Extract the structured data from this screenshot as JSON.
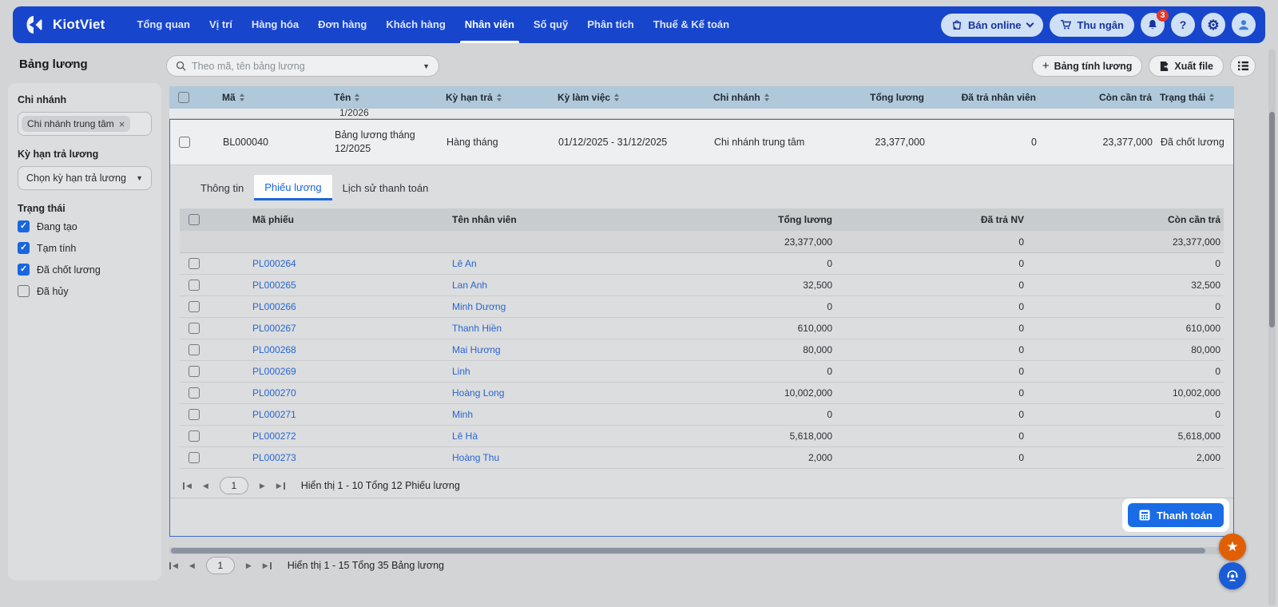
{
  "colors": {
    "navbar": "#1746cd",
    "accent": "#1a6ce6",
    "link": "#2766cf",
    "badge_red": "#e23a2e",
    "header_blue": "#afc9db",
    "star_orange": "#e05f04"
  },
  "nav": {
    "brand": "KiotViet",
    "items": [
      {
        "label": "Tổng quan",
        "active": false
      },
      {
        "label": "Vị trí",
        "active": false
      },
      {
        "label": "Hàng hóa",
        "active": false
      },
      {
        "label": "Đơn hàng",
        "active": false
      },
      {
        "label": "Khách hàng",
        "active": false
      },
      {
        "label": "Nhân viên",
        "active": true
      },
      {
        "label": "Số quỹ",
        "active": false
      },
      {
        "label": "Phân tích",
        "active": false
      },
      {
        "label": "Thuế & Kế toán",
        "active": false
      }
    ],
    "ban_online_label": "Bán online",
    "thu_ngan_label": "Thu ngân",
    "notification_badge": "3",
    "help_glyph": "?",
    "gear_glyph": "⚙"
  },
  "sidebar": {
    "title": "Bảng lương",
    "branch_label": "Chi nhánh",
    "branch_chip": "Chi nhánh trung tâm",
    "chip_close_glyph": "×",
    "term_label": "Kỳ hạn trả lương",
    "term_placeholder": "Chọn kỳ hạn trả lương",
    "status_label": "Trạng thái",
    "statuses": [
      {
        "label": "Đang tạo",
        "checked": true
      },
      {
        "label": "Tạm tính",
        "checked": true
      },
      {
        "label": "Đã chốt lương",
        "checked": true
      },
      {
        "label": "Đã hủy",
        "checked": false
      }
    ]
  },
  "toolbar": {
    "search_placeholder": "Theo mã, tên bảng lương",
    "create_plus_glyph": "+",
    "create_label": "Bảng tính lương",
    "export_label": "Xuất file"
  },
  "outer_table": {
    "headers": [
      {
        "label": "Mã",
        "sort": true,
        "cls": "first"
      },
      {
        "label": "Tên",
        "sort": true,
        "cls": "pad"
      },
      {
        "label": "Kỳ hạn trả",
        "sort": true,
        "cls": "pad"
      },
      {
        "label": "Kỳ làm việc",
        "sort": true,
        "cls": "pad"
      },
      {
        "label": "Chi nhánh",
        "sort": true,
        "cls": "pad"
      },
      {
        "label": "Tổng lương",
        "sort": false,
        "cls": "right"
      },
      {
        "label": "Đã trả nhân viên",
        "sort": false,
        "cls": "right"
      },
      {
        "label": "Còn cần trả",
        "sort": false,
        "cls": "right"
      },
      {
        "label": "Trạng thái",
        "sort": true,
        "cls": ""
      }
    ],
    "partial_row_text": "1/2026",
    "expanded_row": {
      "code": "BL000040",
      "name": "Bảng lương tháng 12/2025",
      "term": "Hàng tháng",
      "period": "01/12/2025 - 31/12/2025",
      "branch": "Chi nhánh trung tâm",
      "total": "23,377,000",
      "paid": "0",
      "remaining": "23,377,000",
      "status": "Đã chốt lương"
    }
  },
  "detail": {
    "tabs": [
      {
        "label": "Thông tin",
        "active": false
      },
      {
        "label": "Phiếu lương",
        "active": true
      },
      {
        "label": "Lịch sử thanh toán",
        "active": false
      }
    ],
    "inner_headers": [
      "Mã phiếu",
      "Tên nhân viên",
      "Tổng lương",
      "Đã trả NV",
      "Còn cần trả"
    ],
    "summary": {
      "total": "23,377,000",
      "paid": "0",
      "remaining": "23,377,000"
    },
    "rows": [
      {
        "code": "PL000264",
        "name": "Lê An",
        "total": "0",
        "paid": "0",
        "remaining": "0"
      },
      {
        "code": "PL000265",
        "name": "Lan Anh",
        "total": "32,500",
        "paid": "0",
        "remaining": "32,500"
      },
      {
        "code": "PL000266",
        "name": "Minh Dương",
        "total": "0",
        "paid": "0",
        "remaining": "0"
      },
      {
        "code": "PL000267",
        "name": "Thanh Hiền",
        "total": "610,000",
        "paid": "0",
        "remaining": "610,000"
      },
      {
        "code": "PL000268",
        "name": "Mai Hương",
        "total": "80,000",
        "paid": "0",
        "remaining": "80,000"
      },
      {
        "code": "PL000269",
        "name": "Linh",
        "total": "0",
        "paid": "0",
        "remaining": "0"
      },
      {
        "code": "PL000270",
        "name": "Hoàng Long",
        "total": "10,002,000",
        "paid": "0",
        "remaining": "10,002,000"
      },
      {
        "code": "PL000271",
        "name": "Minh",
        "total": "0",
        "paid": "0",
        "remaining": "0"
      },
      {
        "code": "PL000272",
        "name": "Lê Hà",
        "total": "5,618,000",
        "paid": "0",
        "remaining": "5,618,000"
      },
      {
        "code": "PL000273",
        "name": "Hoàng Thu",
        "total": "2,000",
        "paid": "0",
        "remaining": "2,000"
      }
    ],
    "pagination": {
      "page": "1",
      "text": "Hiển thị 1 - 10 Tổng 12 Phiếu lương"
    },
    "pay_button_label": "Thanh toán"
  },
  "outer_pagination": {
    "page": "1",
    "text": "Hiển thị 1 - 15 Tổng 35 Bảng lương"
  },
  "floating": {
    "star_glyph": "★"
  }
}
